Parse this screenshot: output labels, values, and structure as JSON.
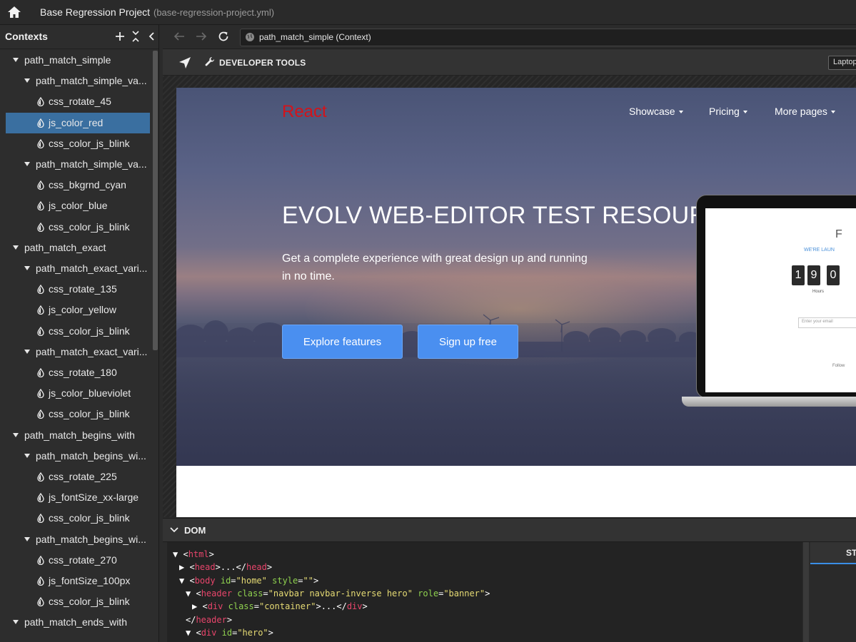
{
  "titlebar": {
    "title": "Base Regression Project",
    "file": "(base-regression-project.yml)"
  },
  "sidebar": {
    "title": "Contexts",
    "items": [
      {
        "label": "path_match_simple",
        "level": 0,
        "kind": "folder"
      },
      {
        "label": "path_match_simple_va...",
        "level": 1,
        "kind": "folder"
      },
      {
        "label": "css_rotate_45",
        "level": 2,
        "kind": "leaf"
      },
      {
        "label": "js_color_red",
        "level": 2,
        "kind": "leaf",
        "selected": true
      },
      {
        "label": "css_color_js_blink",
        "level": 2,
        "kind": "leaf"
      },
      {
        "label": "path_match_simple_va...",
        "level": 1,
        "kind": "folder"
      },
      {
        "label": "css_bkgrnd_cyan",
        "level": 2,
        "kind": "leaf"
      },
      {
        "label": "js_color_blue",
        "level": 2,
        "kind": "leaf"
      },
      {
        "label": "css_color_js_blink",
        "level": 2,
        "kind": "leaf"
      },
      {
        "label": "path_match_exact",
        "level": 0,
        "kind": "folder"
      },
      {
        "label": "path_match_exact_vari...",
        "level": 1,
        "kind": "folder"
      },
      {
        "label": "css_rotate_135",
        "level": 2,
        "kind": "leaf"
      },
      {
        "label": "js_color_yellow",
        "level": 2,
        "kind": "leaf"
      },
      {
        "label": "css_color_js_blink",
        "level": 2,
        "kind": "leaf"
      },
      {
        "label": "path_match_exact_vari...",
        "level": 1,
        "kind": "folder"
      },
      {
        "label": "css_rotate_180",
        "level": 2,
        "kind": "leaf"
      },
      {
        "label": "js_color_blueviolet",
        "level": 2,
        "kind": "leaf"
      },
      {
        "label": "css_color_js_blink",
        "level": 2,
        "kind": "leaf"
      },
      {
        "label": "path_match_begins_with",
        "level": 0,
        "kind": "folder"
      },
      {
        "label": "path_match_begins_wi...",
        "level": 1,
        "kind": "folder"
      },
      {
        "label": "css_rotate_225",
        "level": 2,
        "kind": "leaf"
      },
      {
        "label": "js_fontSize_xx-large",
        "level": 2,
        "kind": "leaf"
      },
      {
        "label": "css_color_js_blink",
        "level": 2,
        "kind": "leaf"
      },
      {
        "label": "path_match_begins_wi...",
        "level": 1,
        "kind": "folder"
      },
      {
        "label": "css_rotate_270",
        "level": 2,
        "kind": "leaf"
      },
      {
        "label": "js_fontSize_100px",
        "level": 2,
        "kind": "leaf"
      },
      {
        "label": "css_color_js_blink",
        "level": 2,
        "kind": "leaf"
      },
      {
        "label": "path_match_ends_with",
        "level": 0,
        "kind": "folder"
      }
    ]
  },
  "nav": {
    "url": "path_match_simple (Context)"
  },
  "toolbar": {
    "devtools_label": "DEVELOPER TOOLS",
    "device": "Laptop"
  },
  "site": {
    "brand": "React",
    "menu": [
      "Showcase",
      "Pricing",
      "More pages"
    ],
    "hero_title": "EVOLV WEB-EDITOR TEST RESOURCE",
    "hero_subtitle": "Get a complete experience with great design up and running in no time.",
    "btn_explore": "Explore features",
    "btn_signup": "Sign up free",
    "laptop": {
      "letter": "F",
      "launch": "WE'RE LAUN",
      "digits": [
        "1",
        "9",
        "0"
      ],
      "hours": "Hours",
      "email_placeholder": "Enter your email",
      "follow": "Follow"
    }
  },
  "dom": {
    "title": "DOM",
    "lines": [
      {
        "indent": 0,
        "arrow": "▼",
        "parts": [
          [
            "pn",
            "<"
          ],
          [
            "tg",
            "html"
          ],
          [
            "pn",
            ">"
          ]
        ]
      },
      {
        "indent": 1,
        "arrow": "▶",
        "parts": [
          [
            "pn",
            "<"
          ],
          [
            "tg",
            "head"
          ],
          [
            "pn",
            ">...</"
          ],
          [
            "tg",
            "head"
          ],
          [
            "pn",
            ">"
          ]
        ]
      },
      {
        "indent": 1,
        "arrow": "▼",
        "parts": [
          [
            "pn",
            "<"
          ],
          [
            "tg",
            "body"
          ],
          [
            "pn",
            " "
          ],
          [
            "at",
            "id"
          ],
          [
            "pn",
            "="
          ],
          [
            "vl",
            "\"home\""
          ],
          [
            "pn",
            " "
          ],
          [
            "at",
            "style"
          ],
          [
            "pn",
            "="
          ],
          [
            "vl",
            "\"\""
          ],
          [
            "pn",
            ">"
          ]
        ]
      },
      {
        "indent": 2,
        "arrow": "▼",
        "parts": [
          [
            "pn",
            "<"
          ],
          [
            "tg",
            "header"
          ],
          [
            "pn",
            " "
          ],
          [
            "at",
            "class"
          ],
          [
            "pn",
            "="
          ],
          [
            "vl",
            "\"navbar navbar-inverse hero\""
          ],
          [
            "pn",
            " "
          ],
          [
            "at",
            "role"
          ],
          [
            "pn",
            "="
          ],
          [
            "vl",
            "\"banner\""
          ],
          [
            "pn",
            ">"
          ]
        ]
      },
      {
        "indent": 3,
        "arrow": "▶",
        "parts": [
          [
            "pn",
            "<"
          ],
          [
            "tg",
            "div"
          ],
          [
            "pn",
            " "
          ],
          [
            "at",
            "class"
          ],
          [
            "pn",
            "="
          ],
          [
            "vl",
            "\"container\""
          ],
          [
            "pn",
            ">...</"
          ],
          [
            "tg",
            "div"
          ],
          [
            "pn",
            ">"
          ]
        ]
      },
      {
        "indent": 2,
        "arrow": "",
        "parts": [
          [
            "pn",
            "</"
          ],
          [
            "tg",
            "header"
          ],
          [
            "pn",
            ">"
          ]
        ]
      },
      {
        "indent": 2,
        "arrow": "▼",
        "parts": [
          [
            "pn",
            "<"
          ],
          [
            "tg",
            "div"
          ],
          [
            "pn",
            " "
          ],
          [
            "at",
            "id"
          ],
          [
            "pn",
            "="
          ],
          [
            "vl",
            "\"hero\""
          ],
          [
            "pn",
            ">"
          ]
        ]
      }
    ]
  },
  "styles": {
    "tab_label": "STYLES"
  },
  "colors": {
    "selection": "#3a6fa0",
    "brand_red": "#d4131a",
    "button_blue": "#4a8ff0",
    "tag": "#e8456b",
    "attr": "#8fd14f",
    "value": "#e6db74"
  }
}
